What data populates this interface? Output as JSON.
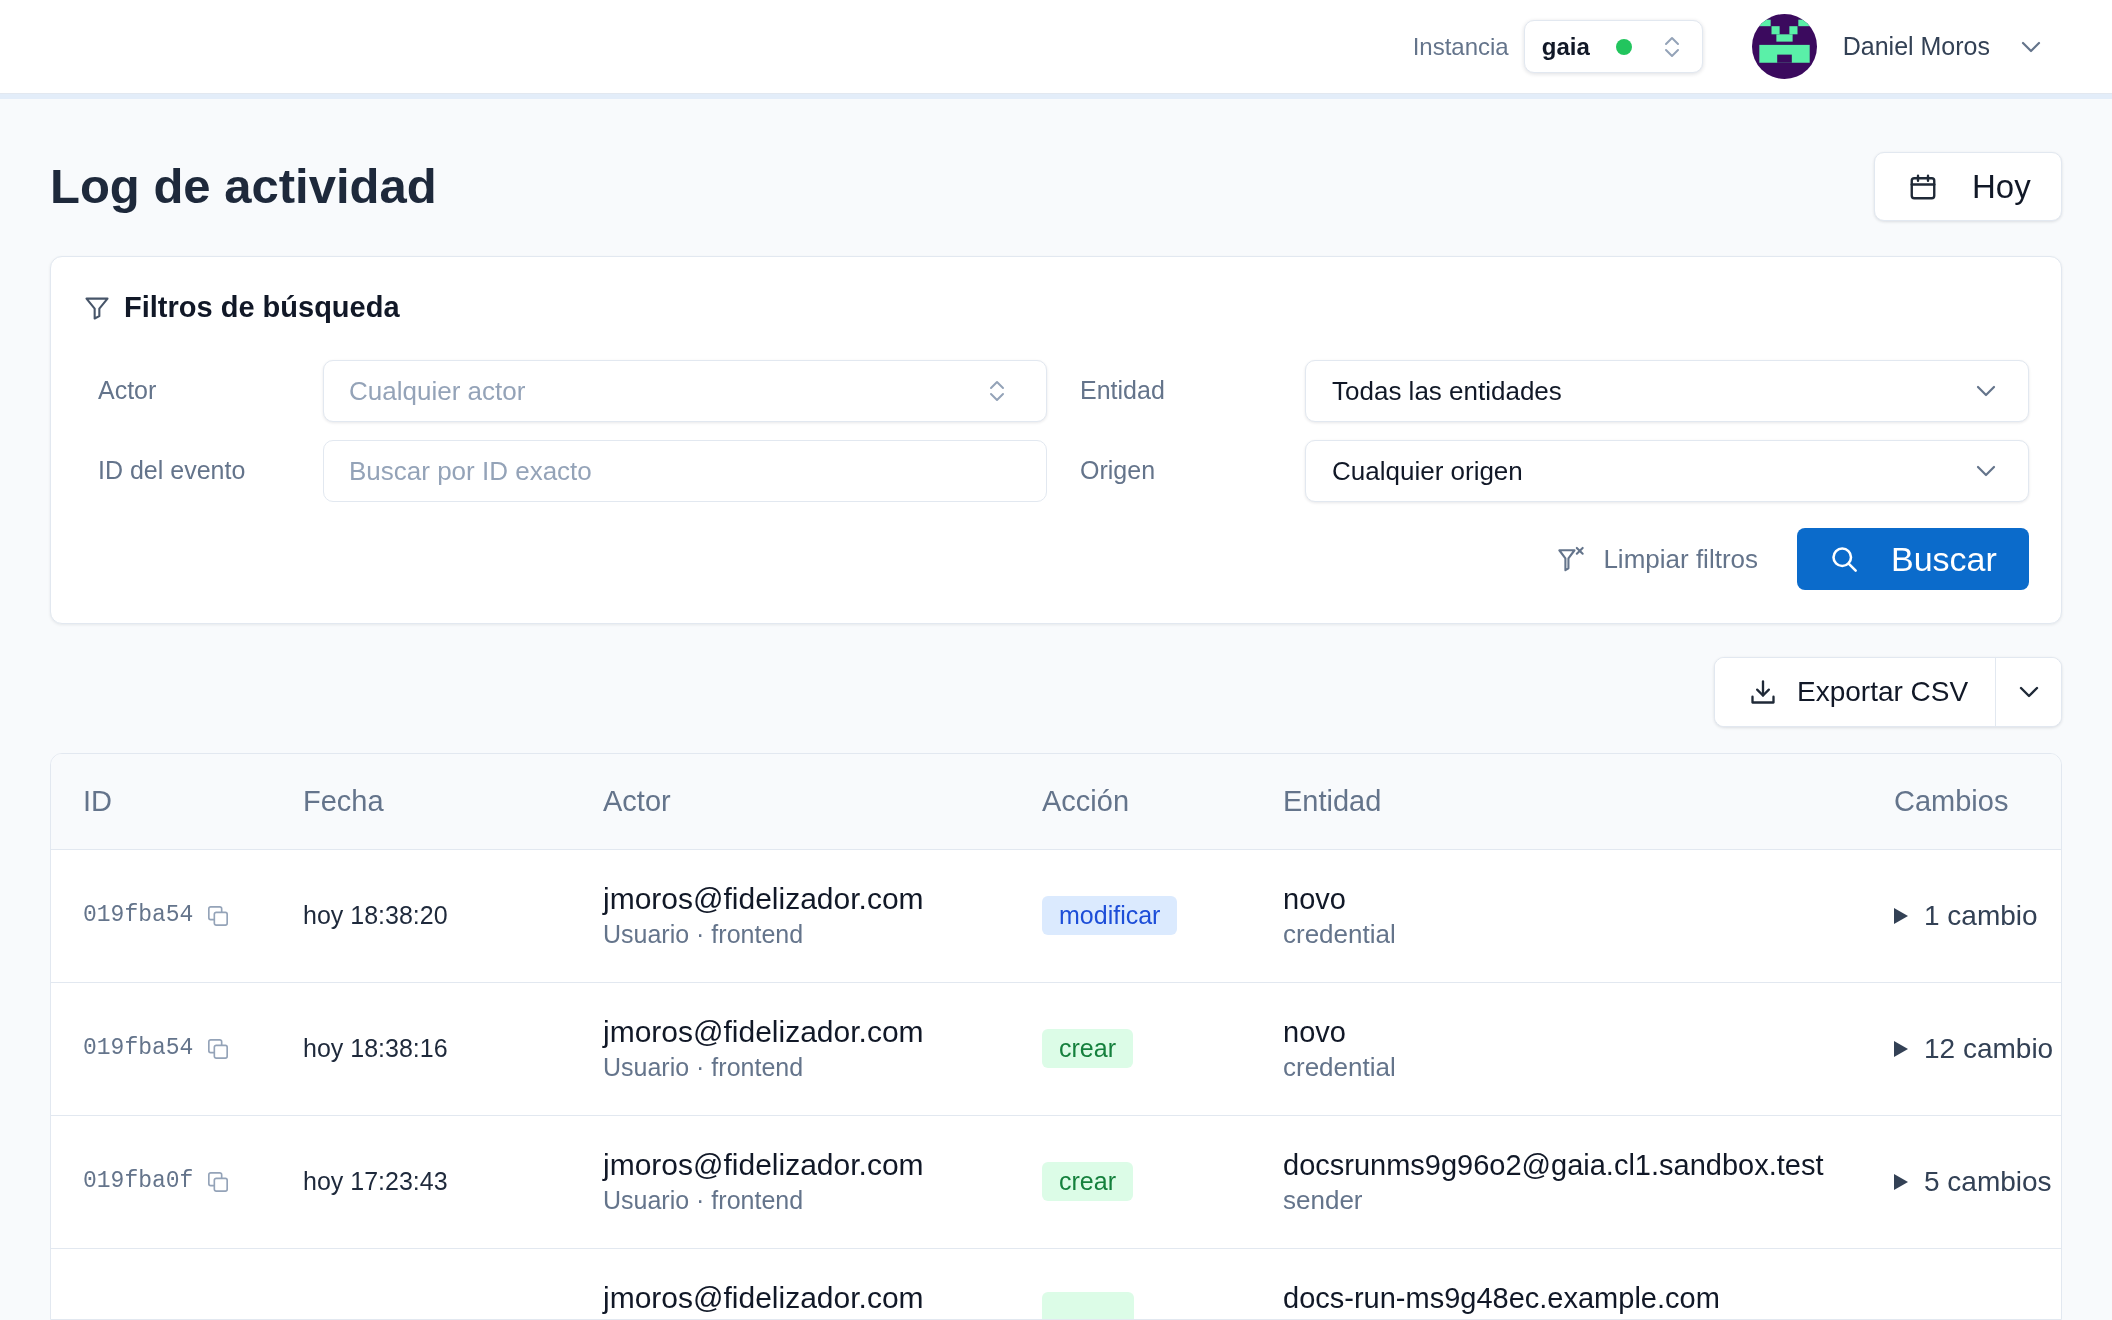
{
  "top_bar": {
    "instance_label": "Instancia",
    "instance": {
      "value": "gaia",
      "online": true
    },
    "user": {
      "name": "Daniel Moros"
    }
  },
  "header": {
    "title": "Log de actividad",
    "date_button": "Hoy"
  },
  "filters": {
    "title": "Filtros de búsqueda",
    "fields": [
      {
        "label": "Actor",
        "kind": "combobox",
        "placeholder": "Cualquier actor"
      },
      {
        "label": "Entidad",
        "kind": "select",
        "value": "Todas las entidades"
      },
      {
        "label": "ID del evento",
        "kind": "text",
        "placeholder": "Buscar por ID exacto"
      },
      {
        "label": "Origen",
        "kind": "select",
        "value": "Cualquier origen"
      }
    ],
    "clear_button": "Limpiar filtros",
    "search_button": "Buscar"
  },
  "export": {
    "label": "Exportar CSV"
  },
  "table": {
    "columns": [
      "ID",
      "Fecha",
      "Actor",
      "Acción",
      "Entidad",
      "Cambios"
    ],
    "rows": [
      {
        "id": "019fba54",
        "date": "hoy 18:38:20",
        "actor": "jmoros@fidelizador.com",
        "actor_detail": "Usuario · frontend",
        "action": {
          "kind": "update",
          "label": "modificar"
        },
        "entity": "novo",
        "entity_type": "credential",
        "changes": {
          "label": "1 cambio",
          "expanded": false
        }
      },
      {
        "id": "019fba54",
        "date": "hoy 18:38:16",
        "actor": "jmoros@fidelizador.com",
        "actor_detail": "Usuario · frontend",
        "action": {
          "kind": "create",
          "label": "crear"
        },
        "entity": "novo",
        "entity_type": "credential",
        "changes": {
          "label": "12 cambio",
          "expanded": false
        }
      },
      {
        "id": "019fba0f",
        "date": "hoy 17:23:43",
        "actor": "jmoros@fidelizador.com",
        "actor_detail": "Usuario · frontend",
        "action": {
          "kind": "create",
          "label": "crear"
        },
        "entity": "docsrunms9g96o2@gaia.cl1.sandbox.test",
        "entity_type": "sender",
        "changes": {
          "label": "5 cambios",
          "expanded": false
        }
      },
      {
        "actor": "jmoros@fidelizador.com",
        "action": {
          "kind": "create"
        },
        "entity": "docs-run-ms9g48ec.example.com"
      }
    ]
  }
}
